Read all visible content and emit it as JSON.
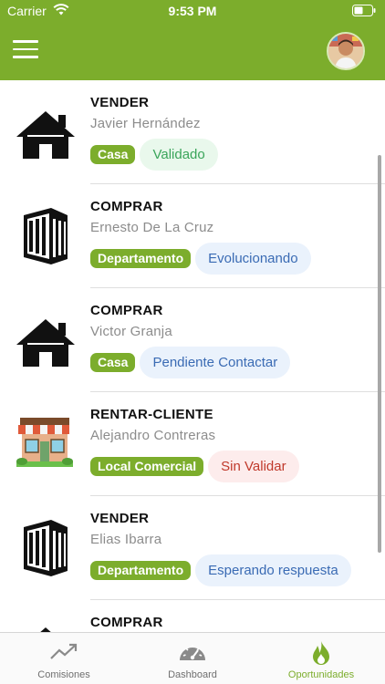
{
  "status_bar": {
    "carrier": "Carrier",
    "time": "9:53 PM"
  },
  "nav": {
    "menu_icon": "hamburger-icon",
    "avatar": "user-avatar"
  },
  "opportunities": [
    {
      "operation": "VENDER",
      "client": "Javier Hernández",
      "property_type": "Casa",
      "status": "Validado",
      "icon": "house-icon",
      "status_color": "#3aa55a"
    },
    {
      "operation": "COMPRAR",
      "client": "Ernesto De La Cruz",
      "property_type": "Departamento",
      "status": "Evolucionando",
      "icon": "building-icon",
      "status_color": "#3a6bb4"
    },
    {
      "operation": "COMPRAR",
      "client": "Victor Granja",
      "property_type": "Casa",
      "status": "Pendiente Contactar",
      "icon": "house-icon",
      "status_color": "#3a6bb4"
    },
    {
      "operation": "RENTAR-CLIENTE",
      "client": "Alejandro Contreras",
      "property_type": "Local Comercial",
      "status": "Sin Validar",
      "icon": "storefront-icon",
      "status_color": "#c0392b"
    },
    {
      "operation": "VENDER",
      "client": "Elias Ibarra",
      "property_type": "Departamento",
      "status": "Esperando respuesta",
      "icon": "building-icon",
      "status_color": "#3a6bb4"
    },
    {
      "operation": "COMPRAR",
      "icon": "house-icon"
    }
  ],
  "tabs": [
    {
      "label": "Comisiones",
      "icon": "trending-up-icon",
      "active": false
    },
    {
      "label": "Dashboard",
      "icon": "speedometer-icon",
      "active": false
    },
    {
      "label": "Oportunidades",
      "icon": "flame-icon",
      "active": true
    }
  ],
  "colors": {
    "brand_green": "#7cad2c",
    "status_green": "#3aa55a",
    "status_blue": "#3a6bb4",
    "status_red": "#c0392b"
  }
}
